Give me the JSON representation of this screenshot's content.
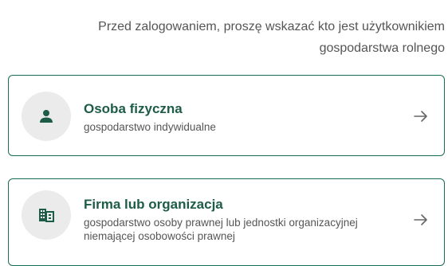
{
  "intro": {
    "text_line1": "Przed zalogowaniem, proszę wskazać kto jest użytkownikiem",
    "text_line2": "gospodarstwa rolnego"
  },
  "options": [
    {
      "title": "Osoba fizyczna",
      "subtitle": "gospodarstwo indywidualne",
      "icon": "person-icon"
    },
    {
      "title": "Firma lub organizacja",
      "subtitle": "gospodarstwo osoby prawnej lub jednostki organizacyjnej niemającej osobowości prawnej",
      "icon": "building-icon"
    }
  ],
  "colors": {
    "accent": "#1a6b55",
    "title": "#1d5c47",
    "avatar_bg": "#ebebeb",
    "arrow": "#666666"
  }
}
